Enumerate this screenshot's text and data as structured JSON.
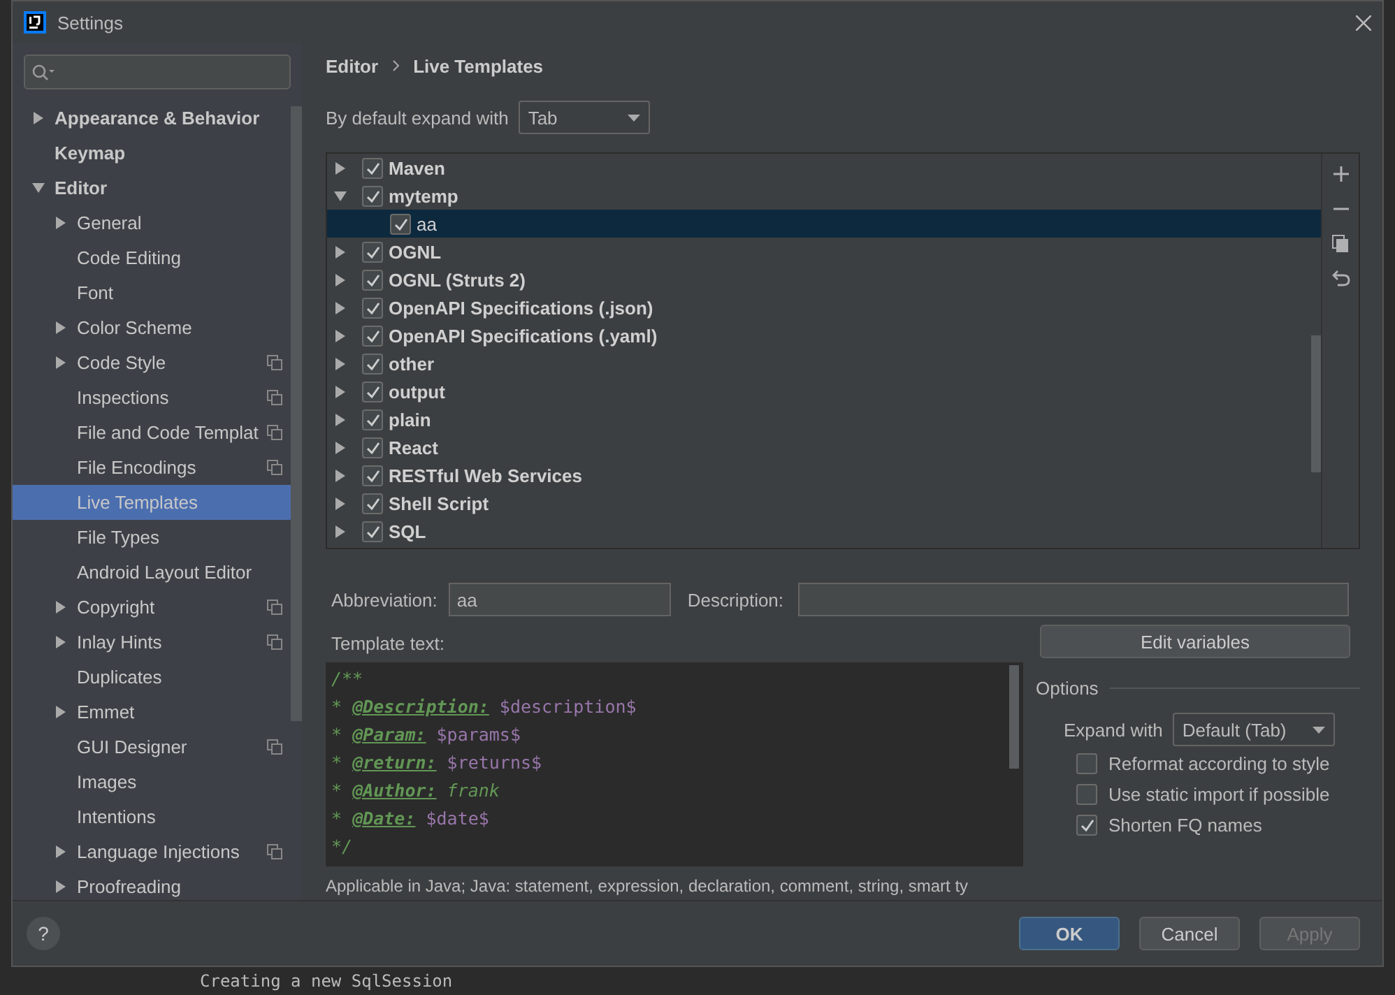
{
  "window": {
    "title": "Settings"
  },
  "sidebar": {
    "items": [
      {
        "label": "Appearance & Behavior",
        "expandable": true,
        "expanded": false,
        "selected": false,
        "shared": false
      },
      {
        "label": "Keymap",
        "expandable": false,
        "expanded": false,
        "selected": false,
        "shared": false
      },
      {
        "label": "Editor",
        "expandable": true,
        "expanded": true,
        "selected": false,
        "shared": false,
        "children": [
          {
            "label": "General",
            "expandable": true,
            "expanded": false,
            "selected": false,
            "shared": false
          },
          {
            "label": "Code Editing",
            "expandable": false,
            "expanded": false,
            "selected": false,
            "shared": false
          },
          {
            "label": "Font",
            "expandable": false,
            "expanded": false,
            "selected": false,
            "shared": false
          },
          {
            "label": "Color Scheme",
            "expandable": true,
            "expanded": false,
            "selected": false,
            "shared": false
          },
          {
            "label": "Code Style",
            "expandable": true,
            "expanded": false,
            "selected": false,
            "shared": true
          },
          {
            "label": "Inspections",
            "expandable": false,
            "expanded": false,
            "selected": false,
            "shared": true
          },
          {
            "label": "File and Code Templat",
            "expandable": false,
            "expanded": false,
            "selected": false,
            "shared": true
          },
          {
            "label": "File Encodings",
            "expandable": false,
            "expanded": false,
            "selected": false,
            "shared": true
          },
          {
            "label": "Live Templates",
            "expandable": false,
            "expanded": false,
            "selected": true,
            "shared": false
          },
          {
            "label": "File Types",
            "expandable": false,
            "expanded": false,
            "selected": false,
            "shared": false
          },
          {
            "label": "Android Layout Editor",
            "expandable": false,
            "expanded": false,
            "selected": false,
            "shared": false
          },
          {
            "label": "Copyright",
            "expandable": true,
            "expanded": false,
            "selected": false,
            "shared": true
          },
          {
            "label": "Inlay Hints",
            "expandable": true,
            "expanded": false,
            "selected": false,
            "shared": true
          },
          {
            "label": "Duplicates",
            "expandable": false,
            "expanded": false,
            "selected": false,
            "shared": false
          },
          {
            "label": "Emmet",
            "expandable": true,
            "expanded": false,
            "selected": false,
            "shared": false
          },
          {
            "label": "GUI Designer",
            "expandable": false,
            "expanded": false,
            "selected": false,
            "shared": true
          },
          {
            "label": "Images",
            "expandable": false,
            "expanded": false,
            "selected": false,
            "shared": false
          },
          {
            "label": "Intentions",
            "expandable": false,
            "expanded": false,
            "selected": false,
            "shared": false
          },
          {
            "label": "Language Injections",
            "expandable": true,
            "expanded": false,
            "selected": false,
            "shared": true
          },
          {
            "label": "Proofreading",
            "expandable": true,
            "expanded": false,
            "selected": false,
            "shared": false
          }
        ]
      }
    ]
  },
  "breadcrumb": [
    "Editor",
    "Live Templates"
  ],
  "expand_default": {
    "label": "By default expand with",
    "value": "Tab"
  },
  "templates": [
    {
      "label": "Maven",
      "checked": true,
      "expanded": false,
      "selected": false
    },
    {
      "label": "mytemp",
      "checked": true,
      "expanded": true,
      "selected": false,
      "children": [
        {
          "label": "aa",
          "checked": true,
          "selected": true
        }
      ]
    },
    {
      "label": "OGNL",
      "checked": true,
      "expanded": false,
      "selected": false
    },
    {
      "label": "OGNL (Struts 2)",
      "checked": true,
      "expanded": false,
      "selected": false
    },
    {
      "label": "OpenAPI Specifications (.json)",
      "checked": true,
      "expanded": false,
      "selected": false
    },
    {
      "label": "OpenAPI Specifications (.yaml)",
      "checked": true,
      "expanded": false,
      "selected": false
    },
    {
      "label": "other",
      "checked": true,
      "expanded": false,
      "selected": false
    },
    {
      "label": "output",
      "checked": true,
      "expanded": false,
      "selected": false
    },
    {
      "label": "plain",
      "checked": true,
      "expanded": false,
      "selected": false
    },
    {
      "label": "React",
      "checked": true,
      "expanded": false,
      "selected": false
    },
    {
      "label": "RESTful Web Services",
      "checked": true,
      "expanded": false,
      "selected": false
    },
    {
      "label": "Shell Script",
      "checked": true,
      "expanded": false,
      "selected": false
    },
    {
      "label": "SQL",
      "checked": true,
      "expanded": false,
      "selected": false
    }
  ],
  "abbreviation": {
    "label": "Abbreviation:",
    "value": "aa"
  },
  "description": {
    "label": "Description:"
  },
  "template_text": {
    "label": "Template text:",
    "lines": [
      [
        {
          "kind": "comment",
          "text": "/**"
        }
      ],
      [
        {
          "kind": "comment",
          "text": "* "
        },
        {
          "kind": "tag",
          "text": "@Description:"
        },
        {
          "kind": "variable",
          "text": " $description$"
        }
      ],
      [
        {
          "kind": "comment",
          "text": "* "
        },
        {
          "kind": "tag",
          "text": "@Param:"
        },
        {
          "kind": "variable",
          "text": " $params$"
        }
      ],
      [
        {
          "kind": "comment",
          "text": "* "
        },
        {
          "kind": "tag",
          "text": "@return:"
        },
        {
          "kind": "variable",
          "text": " $returns$"
        }
      ],
      [
        {
          "kind": "comment",
          "text": "* "
        },
        {
          "kind": "tag",
          "text": "@Author:"
        },
        {
          "kind": "comment",
          "text": " frank"
        }
      ],
      [
        {
          "kind": "comment",
          "text": "* "
        },
        {
          "kind": "tag",
          "text": "@Date:"
        },
        {
          "kind": "variable",
          "text": " $date$"
        }
      ],
      [
        {
          "kind": "comment",
          "text": "*/"
        }
      ]
    ]
  },
  "edit_variables": "Edit variables",
  "options": {
    "title": "Options",
    "expand_with": {
      "label": "Expand with",
      "value": "Default (Tab)"
    },
    "checkboxes": [
      {
        "label": "Reformat according to style",
        "checked": false
      },
      {
        "label": "Use static import if possible",
        "checked": false
      },
      {
        "label": "Shorten FQ names",
        "checked": true
      }
    ]
  },
  "applicable": "Applicable in Java; Java: statement, expression, declaration, comment, string, smart ty",
  "footer": {
    "help": "?",
    "buttons": [
      {
        "label": "OK",
        "kind": "primary",
        "disabled": false
      },
      {
        "label": "Cancel",
        "kind": "normal",
        "disabled": false
      },
      {
        "label": "Apply",
        "kind": "normal",
        "disabled": true
      }
    ]
  },
  "console_line": "Creating a new SqlSession"
}
